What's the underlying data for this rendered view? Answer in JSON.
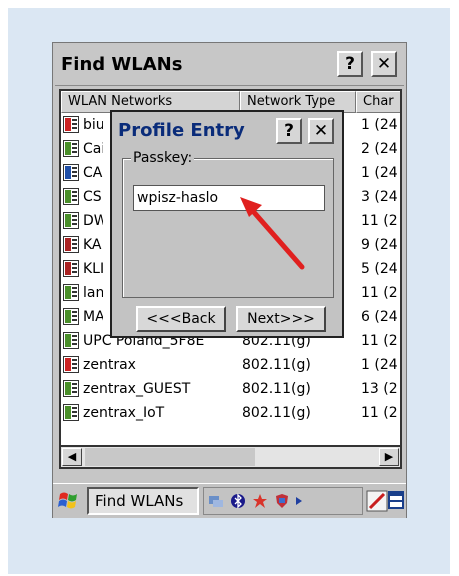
{
  "window": {
    "title": "Find WLANs",
    "help_label": "?",
    "close_label": "✕"
  },
  "table": {
    "headers": [
      "WLAN Networks",
      "Network Type",
      "Channel"
    ],
    "header_display": [
      "WLAN Networks",
      "Network Type",
      "Char"
    ],
    "rows": [
      {
        "name": "biur",
        "type": "",
        "channel": "1 (24",
        "icon": "secured-network-icon",
        "icon_color": "#cc2222"
      },
      {
        "name": "Cai",
        "type": "",
        "channel": "2 (24",
        "icon": "network-icon",
        "icon_color": "#4a8f2a"
      },
      {
        "name": "CA",
        "type": "",
        "channel": "1 (24",
        "icon": "network-icon",
        "icon_color": "#1f4fa8"
      },
      {
        "name": "CS",
        "type": "",
        "channel": "3 (24",
        "icon": "network-icon",
        "icon_color": "#4a8f2a"
      },
      {
        "name": "DW",
        "type": "",
        "channel": "11 (2",
        "icon": "network-icon",
        "icon_color": "#4a8f2a"
      },
      {
        "name": "KA",
        "type": "",
        "channel": "9 (24",
        "icon": "network-icon",
        "icon_color": "#aa2222"
      },
      {
        "name": "KLI",
        "type": "",
        "channel": "5 (24",
        "icon": "network-icon",
        "icon_color": "#aa2222"
      },
      {
        "name": "lan",
        "type": "",
        "channel": "11 (2",
        "icon": "network-icon",
        "icon_color": "#4a8f2a"
      },
      {
        "name": "MA",
        "type": "",
        "channel": "6 (24",
        "icon": "network-icon",
        "icon_color": "#4a8f2a"
      },
      {
        "name": "UPC Poland_5F8E",
        "type": "802.11(g)",
        "channel": "11 (2",
        "icon": "network-icon",
        "icon_color": "#4a8f2a"
      },
      {
        "name": "zentrax",
        "type": "802.11(g)",
        "channel": "1 (24",
        "icon": "secured-network-icon",
        "icon_color": "#cc2222"
      },
      {
        "name": "zentrax_GUEST",
        "type": "802.11(g)",
        "channel": "13 (2",
        "icon": "network-icon",
        "icon_color": "#4a8f2a"
      },
      {
        "name": "zentrax_IoT",
        "type": "802.11(g)",
        "channel": "11 (2",
        "icon": "network-icon",
        "icon_color": "#4a8f2a"
      }
    ]
  },
  "dialog": {
    "title": "Profile Entry",
    "help_label": "?",
    "close_label": "✕",
    "group_label": "Passkey:",
    "passkey_value": "wpisz-haslo",
    "back_label": "<<<Back",
    "next_label": "Next>>>"
  },
  "taskbar": {
    "task_label": "Find WLANs",
    "tray_icons": [
      "network-icon",
      "bluetooth-icon",
      "star-icon",
      "shield-icon",
      "arrow-icon",
      "pen-icon",
      "window-icon"
    ]
  },
  "colors": {
    "annotation_arrow": "#e0201f",
    "panel_background": "#dbe7f3",
    "dialog_title": "#0a2c7a"
  }
}
